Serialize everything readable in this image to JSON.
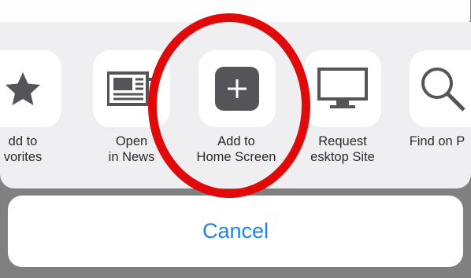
{
  "share_sheet": {
    "actions": [
      {
        "label": "dd to\nvorites",
        "icon": "star-icon"
      },
      {
        "label": "Open\nin News",
        "icon": "news-icon"
      },
      {
        "label": "Add to\nHome Screen",
        "icon": "add-square-icon"
      },
      {
        "label": "Request\nesktop Site",
        "icon": "desktop-icon"
      },
      {
        "label": "Find on P",
        "icon": "magnifier-icon"
      }
    ],
    "cancel_label": "Cancel"
  },
  "colors": {
    "highlight_ring": "#e10a0a",
    "cancel_text": "#1f80f5",
    "icon_fill": "#555459"
  }
}
